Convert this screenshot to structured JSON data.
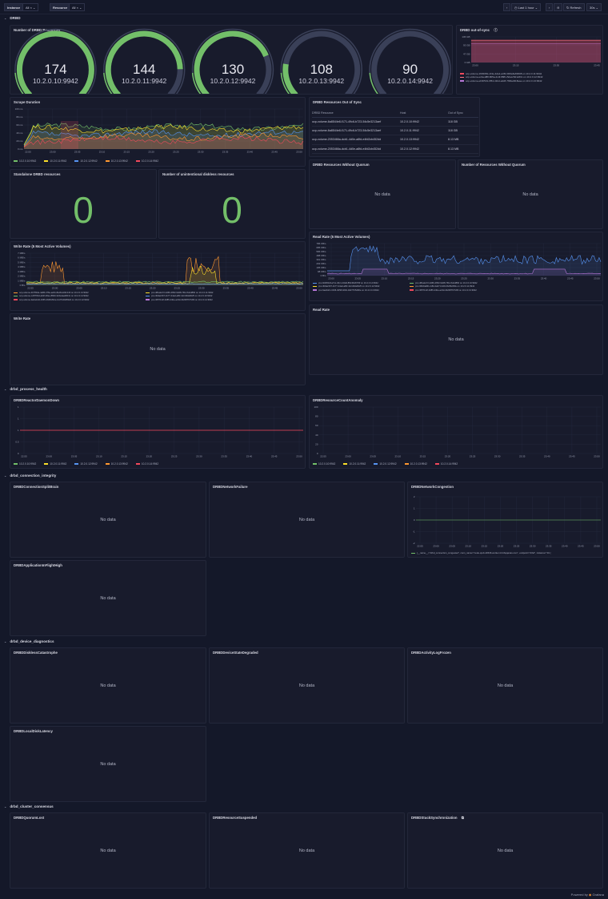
{
  "topbar": {
    "var1_label": "Instance",
    "var1_value": "All",
    "var2_label": "Resource",
    "var2_value": "All",
    "time_range": "Last 1 hour",
    "refresh_label": "Refresh",
    "refresh_interval": "30s"
  },
  "sections": {
    "drbd": "DRBD",
    "process_health": "drbd_process_health",
    "connection_integrity": "drbd_connection_integrity",
    "device_diagnostics": "drbd_device_diagnostics",
    "cluster_consensus": "drbd_cluster_consensus"
  },
  "panels": {
    "num_resources": "Number of DRBD Resources",
    "out_of_sync": "DRBD out-of-sync",
    "scrape_duration": "Scrape Duration",
    "resources_out_of_sync": "DRBD Resources Out of Sync",
    "standalone": "Standalone DRBD resources",
    "diskless": "Number of unintentional diskless resources",
    "without_quorum": "DRBD Resources Without Quorum",
    "num_without_quorum": "Number of Resources Without Quorum",
    "write_rate_top": "Write Rate (5 Most Active Volumes)",
    "read_rate_top": "Read Rate (5 Most Active Volumes)",
    "write_rate": "Write Rate",
    "read_rate": "Read Rate",
    "reactor_down": "DRBDReactorDaemonDown",
    "resource_count_anomaly": "DRBDResourceCountAnomaly",
    "split_brain": "DRBDConnectionSplitBrain",
    "network_failure": "DRBDNetworkFailure",
    "network_congestion": "DRBDNetworkCongestion",
    "app_inflight": "DRBDApplicationInFlightHigh",
    "diskless_catastrophe": "DRBDDisklessCatastrophe",
    "device_degraded": "DRBDDeviceStateDegraded",
    "activity_log_frozen": "DRBDActivityLogFrozen",
    "local_disk_latency": "DRBDLocalDiskLatency",
    "quorum_lost": "DRBDQuorumLost",
    "resource_suspended": "DRBDResourceSuspended",
    "stuck_sync": "DRBDStuckSynchronization"
  },
  "no_data": "No data",
  "stats": {
    "standalone": "0",
    "diskless": "0"
  },
  "gauges": [
    {
      "value": "174",
      "instance": "10.2.0.10:9942",
      "fraction": 1.0
    },
    {
      "value": "144",
      "instance": "10.2.0.11:9942",
      "fraction": 0.83
    },
    {
      "value": "130",
      "instance": "10.2.0.12:9942",
      "fraction": 0.75
    },
    {
      "value": "108",
      "instance": "10.2.0.13:9942",
      "fraction": 0.2
    },
    {
      "value": "90",
      "instance": "10.2.0.14:9942",
      "fraction": 0.0
    }
  ],
  "instances": [
    "10.2.0.10:9942",
    "10.2.0.11:9942",
    "10.2.0.12:9942",
    "10.2.0.13:9942",
    "10.2.0.14:9942"
  ],
  "out_of_sync_legend": [
    "ocp-volume-1f3f2081-c43e-4da1-a4f3-00f4a6e83608 on 10.2.0.11:9942",
    "ocp-volume-ecfeed88-805a-4cdf-8881-5dacc5d1e50c on 10.2.0.12:9942",
    "ocp-volume-ebf1f531-0f54-41bd-a4c8-7f00ad318eae on 10.2.0.13:9942"
  ],
  "out_of_sync_table": {
    "columns": [
      "DRBD Resource",
      "Host",
      "Out of Sync"
    ],
    "rows": [
      [
        "ocp-volume-6a8544e8-f171-49c6-b723-54c5e3213aef",
        "10.2.0.10:9942",
        "118 GB"
      ],
      [
        "ocp-volume-6a8544e8-f171-49c6-b723-54c5e3213aef",
        "10.2.0.11:9942",
        "118 GB"
      ],
      [
        "ocp-volume-2053466a-dcb1-4d0e-a8fd-e4fd2cb452dd",
        "10.2.0.13:9942",
        "8.13 MB"
      ],
      [
        "ocp-volume-2053466a-dcb1-4d0e-a8fd-e4fd2cb452dd",
        "10.2.0.12:9942",
        "8.13 MB"
      ],
      [
        "ocp-volume-2053466a-dcb1-4d0e-a8fd-e4fd2cb452dd",
        "10.2.0.14:9942",
        "8.13 MB"
      ],
      [
        "ocp-volume-e973b7fe-dec3-40ad-96b8-9cd63b1f079f",
        "10.2.0.11:9942",
        "6.36 MB"
      ]
    ]
  },
  "write_legend": [
    "ocp-volume-4b7ff0de-4a86-476e-acbb-8a16ce69c140 on 10.2.0.13:9942",
    "pvc-d8ca2e72-2d66-4652-9d28-7f0ccb4cd860 on 10.2.0.11:9942",
    "ocp-volume-cc87f0bd-a64f-48ee-8820-324a1aab813c on 10.2.0.14:9942",
    "pvc-3b0a2167-1b77-44ad-a8fc-32cd33a6025 on 10.2.0.10:9942",
    "ocp-volume-fadcebd4-1965-4948-80ce-bcd7440d832d on 10.2.0.12:9942",
    "pvc-3057111f-3d85-44be-ac9d-4b2087f37c83 on 10.2.0.14:9942"
  ],
  "read_legend": [
    "pvc-bbbf6bdf-a71c-40c1-94dd-8f0c9b2f370f on 10.2.0.14:9942",
    "pvc-d8ca2e72-2d66-4652-9d28-7f0ccb4cd860 on 10.2.0.10:9942",
    "pvc-3b0a2167-1b77-44ad-a8fc-32cd33a6025 on 10.2.0.12:9942",
    "pvc-0822da80-c18d-4a07-b429-0b2f6e59fe on 10.2.0.11:9942",
    "pvc-6ae6dc1-0196-4b58-b0b0-0d277b5d90e on 10.2.0.13:9942",
    "pvc-3057111f-3d85-44be-ac9d-4b2087f37c83 on 10.2.0.13:9942"
  ],
  "congestion_legend": "{__name__=\"drbd_connection_congested\", conn_name=\"node-qnvk-kb529-worker-t4.lnbqqanas.com\", endpoint=\"drbd\", instance=\"10.(",
  "time_ticks": [
    "22:55",
    "23:00",
    "23:05",
    "23:10",
    "23:15",
    "23:20",
    "23:25",
    "23:30",
    "23:35",
    "23:40",
    "23:45",
    "23:50"
  ],
  "time_ticks_short": [
    "23:00",
    "23:15",
    "23:30",
    "23:45"
  ],
  "oos_yticks": [
    "136 GB",
    "93 GB",
    "47 GB",
    "0 GB"
  ],
  "scrape_yticks": [
    "100 ms",
    "80 ms",
    "60 ms",
    "40 ms",
    "20 ms",
    "0 ms"
  ],
  "write_yticks": [
    "7 MB/s",
    "6 MB/s",
    "5 MB/s",
    "4 MB/s",
    "3 MB/s",
    "2 MB/s",
    "1 MB/s",
    "0 B/s"
  ],
  "read_yticks": [
    "786 KB/s",
    "685 KB/s",
    "586 KB/s",
    "488 KB/s",
    "391 KB/s",
    "293 KB/s",
    "195 KB/s",
    "98 KB/s",
    "0 B/s"
  ],
  "reactor_yticks": [
    "1",
    "1",
    "1",
    "0.5",
    "0"
  ],
  "anomaly_yticks": [
    "100",
    "80",
    "60",
    "40",
    "20",
    "0"
  ],
  "congestion_yticks": [
    "2",
    "1",
    "0",
    "-1",
    "-2"
  ],
  "footer": {
    "powered": "Powered by",
    "brand": "Grafana"
  },
  "colors": {
    "green": "#73bf69",
    "yellow": "#fade2a",
    "blue": "#5794f2",
    "orange": "#ff9830",
    "red": "#f2495c",
    "purple": "#b877d9"
  }
}
